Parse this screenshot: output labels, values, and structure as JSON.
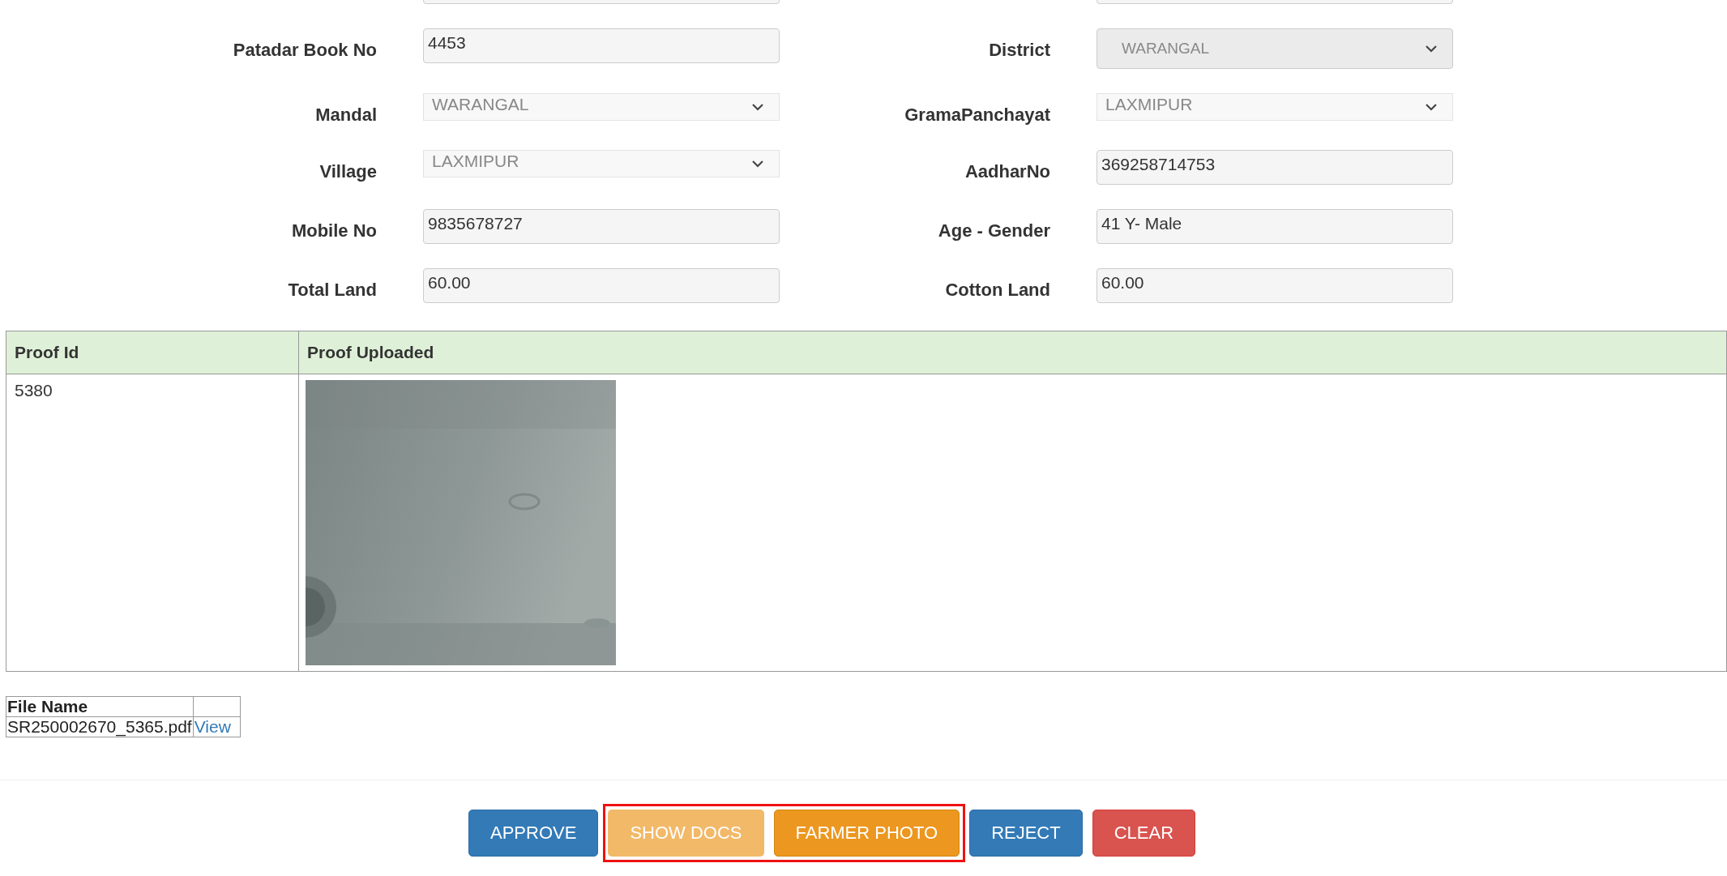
{
  "form": [
    {
      "label": "Patadar Book No",
      "value": "4453",
      "kind": "text",
      "disabled": false
    },
    {
      "label": "District",
      "value": "WARANGAL",
      "kind": "select-boxed",
      "disabled": true
    },
    {
      "label": "Mandal",
      "value": "WARANGAL",
      "kind": "select",
      "disabled": true
    },
    {
      "label": "GramaPanchayat",
      "value": "LAXMIPUR",
      "kind": "select",
      "disabled": true
    },
    {
      "label": "Village",
      "value": "LAXMIPUR",
      "kind": "select",
      "disabled": true
    },
    {
      "label": "AadharNo",
      "value": "369258714753",
      "kind": "text",
      "disabled": false
    },
    {
      "label": "Mobile No",
      "value": "9835678727",
      "kind": "text",
      "disabled": false
    },
    {
      "label": "Age - Gender",
      "value": "41 Y- Male",
      "kind": "text",
      "disabled": false
    },
    {
      "label": "Total Land",
      "value": "60.00",
      "kind": "text",
      "disabled": false
    },
    {
      "label": "Cotton Land",
      "value": "60.00",
      "kind": "text",
      "disabled": false
    }
  ],
  "proof_table": {
    "columns": [
      "Proof Id",
      "Proof Uploaded"
    ],
    "rows": [
      {
        "proof_id": "5380"
      }
    ]
  },
  "file_table": {
    "columns": [
      "File Name"
    ],
    "rows": [
      {
        "file_name": "SR250002670_5365.pdf",
        "link": "View"
      }
    ]
  },
  "buttons": [
    {
      "label": "APPROVE",
      "kind": "primary"
    },
    {
      "label": "SHOW DOCS",
      "kind": "warning-light"
    },
    {
      "label": "FARMER PHOTO",
      "kind": "warning"
    },
    {
      "label": "REJECT",
      "kind": "primary"
    },
    {
      "label": "CLEAR",
      "kind": "danger"
    }
  ]
}
